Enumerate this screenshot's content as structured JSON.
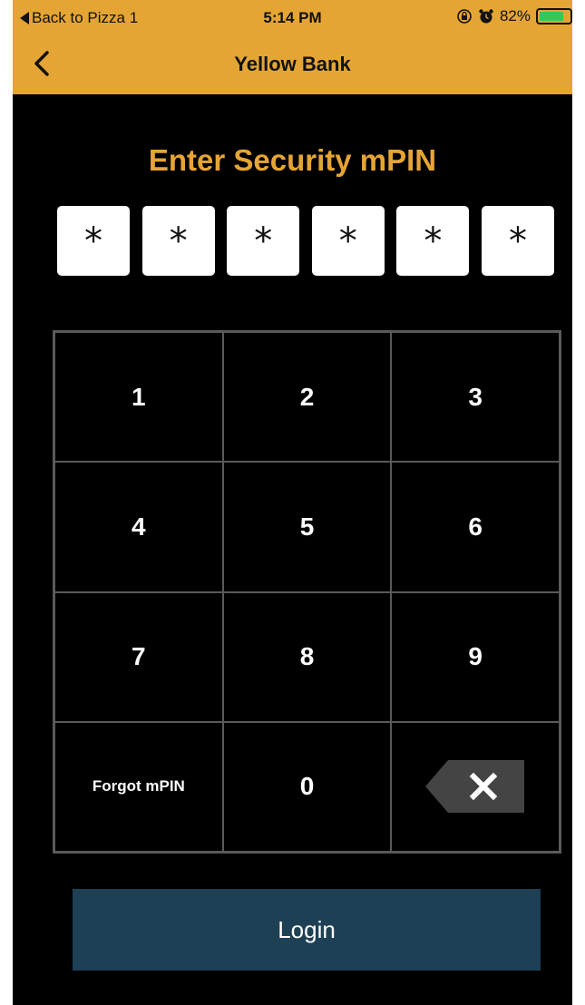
{
  "status_bar": {
    "back_app_label": "Back to Pizza 1",
    "time": "5:14 PM",
    "battery_percent": "82%",
    "battery_level": 0.82,
    "icons": [
      "orientation-lock-icon",
      "alarm-clock-icon",
      "battery-icon"
    ]
  },
  "nav": {
    "title": "Yellow Bank",
    "back_icon": "chevron-left-icon"
  },
  "pin": {
    "heading": "Enter Security mPIN",
    "masked_digits": [
      "*",
      "*",
      "*",
      "*",
      "*",
      "*"
    ]
  },
  "keypad": {
    "keys": [
      "1",
      "2",
      "3",
      "4",
      "5",
      "6",
      "7",
      "8",
      "9"
    ],
    "forgot_label": "Forgot mPIN",
    "zero": "0",
    "backspace_icon": "backspace-icon"
  },
  "login": {
    "label": "Login"
  },
  "colors": {
    "accent": "#e5a535",
    "background": "#000000",
    "login_button": "#1e4055",
    "keypad_border": "#5a5a5a"
  }
}
